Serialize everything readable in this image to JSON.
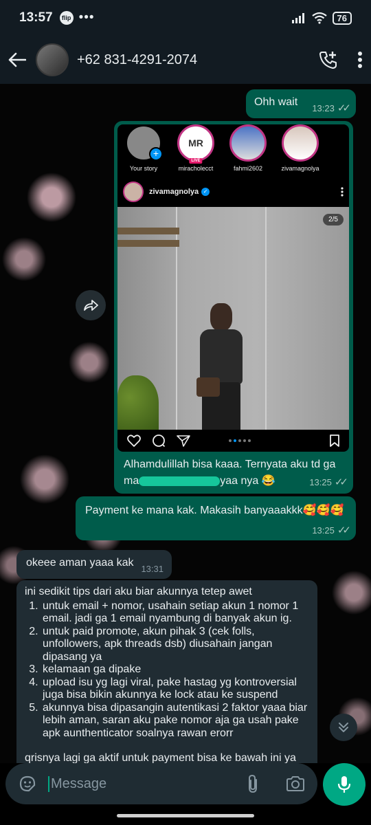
{
  "status": {
    "time": "13:57",
    "flip_badge": "flip",
    "more": "•••",
    "battery": "76"
  },
  "header": {
    "contact": "+62 831-4291-2074"
  },
  "icons": {
    "back": "back-arrow-icon",
    "add_call": "add-call-icon",
    "more": "kebab-menu-icon",
    "forward": "forward-icon",
    "emoji": "sticker-icon",
    "attach": "paperclip-icon",
    "camera": "camera-icon",
    "mic": "microphone-icon",
    "scroll_down": "double-chevron-down-icon"
  },
  "colors": {
    "outgoing": "#005c4b",
    "incoming": "#202c33",
    "accent": "#00a884"
  },
  "messages": {
    "m1": {
      "text": "Ohh wait",
      "time": "13:23"
    },
    "m2": {
      "instagram": {
        "stories": [
          "Your story",
          "miracholecct",
          "fahmi2602",
          "zivamagnolya"
        ],
        "mr_text": "MR",
        "live": "LIVE",
        "post_user": "zivamagnolya",
        "counter": "2/5"
      },
      "caption_a": "Alhamdulillah bisa kaaa. Ternyata aku td ga",
      "caption_b_start": "ma",
      "caption_b_end": "yaa nya 😂",
      "time": "13:25"
    },
    "m3": {
      "text": "Payment ke mana kak. Makasih banyaaakkk🥰🥰🥰",
      "time": "13:25"
    },
    "m4": {
      "text": "okeee aman yaaa kak",
      "time": "13:31"
    },
    "m5": {
      "intro": "ini sedikit tips dari aku biar akunnya tetep awet",
      "items": [
        "untuk email + nomor, usahain setiap akun 1 nomor 1 email. jadi ga 1 email nyambung di banyak akun ig.",
        "untuk paid promote, akun pihak 3 (cek folls, unfollowers, apk threads dsb) diusahain jangan dipasang ya",
        "kelamaan ga dipake",
        "upload isu yg lagi viral, pake hastag yg kontroversial juga bisa bikin akunnya ke lock atau ke suspend",
        "akunnya bisa dipasangin autentikasi 2 faktor yaaa biar lebih aman, saran aku pake nomor aja ga usah pake apk aunthenticator soalnya rawan erorr"
      ],
      "trailing": "qrisnya lagi ga aktif untuk payment bisa ke bawah ini ya"
    }
  },
  "input": {
    "placeholder": "Message"
  }
}
